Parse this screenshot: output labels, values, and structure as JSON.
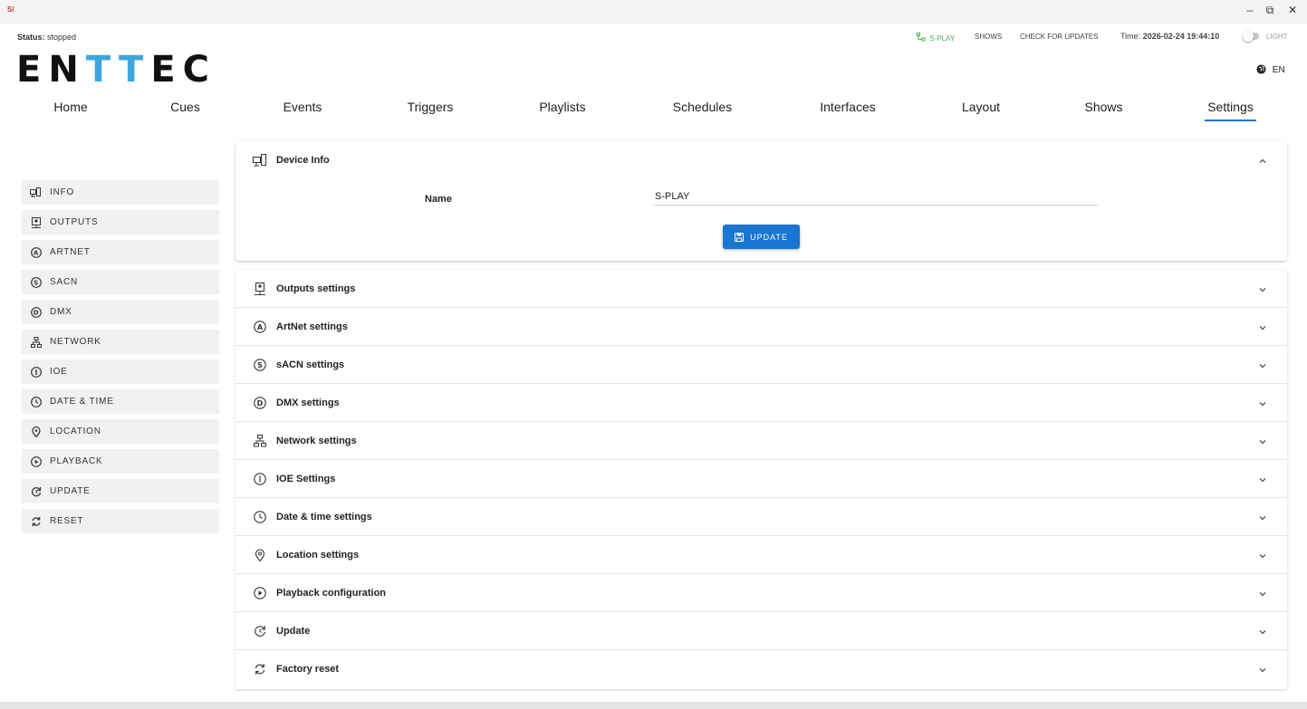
{
  "window": {
    "app_icon": "S/",
    "controls": [
      "–",
      "⧉",
      "✕"
    ]
  },
  "status": {
    "label": "Status:",
    "value": "stopped"
  },
  "logo": {
    "part1": "EN",
    "part2": "TT",
    "part3": "EC"
  },
  "topbar": {
    "splay": "S-PLAY",
    "shows": "SHOWS",
    "check_updates": "CHECK FOR UPDATES",
    "time_label": "Time:",
    "time_value": "2026-02-24 19:44:10",
    "theme_label": "LIGHT",
    "language": "EN"
  },
  "nav": {
    "items": [
      "Home",
      "Cues",
      "Events",
      "Triggers",
      "Playlists",
      "Schedules",
      "Interfaces",
      "Layout",
      "Shows",
      "Settings"
    ],
    "active": "Settings"
  },
  "sidebar": {
    "items": [
      {
        "label": "INFO",
        "icon": "device-info-icon"
      },
      {
        "label": "OUTPUTS",
        "icon": "outputs-icon"
      },
      {
        "label": "ARTNET",
        "icon": "artnet-icon"
      },
      {
        "label": "SACN",
        "icon": "sacn-icon"
      },
      {
        "label": "DMX",
        "icon": "dmx-icon"
      },
      {
        "label": "NETWORK",
        "icon": "network-icon"
      },
      {
        "label": "IOE",
        "icon": "ioe-icon"
      },
      {
        "label": "DATE & TIME",
        "icon": "clock-icon"
      },
      {
        "label": "LOCATION",
        "icon": "location-pin-icon"
      },
      {
        "label": "PLAYBACK",
        "icon": "play-circle-icon"
      },
      {
        "label": "UPDATE",
        "icon": "update-icon"
      },
      {
        "label": "RESET",
        "icon": "reset-icon"
      }
    ]
  },
  "device_info": {
    "title": "Device Info",
    "name_label": "Name",
    "name_value": "S-PLAY",
    "update_button": "UPDATE"
  },
  "sections": [
    {
      "label": "Outputs settings",
      "icon": "outputs-icon"
    },
    {
      "label": "ArtNet settings",
      "icon": "artnet-icon"
    },
    {
      "label": "sACN settings",
      "icon": "sacn-icon"
    },
    {
      "label": "DMX settings",
      "icon": "dmx-icon"
    },
    {
      "label": "Network settings",
      "icon": "network-icon"
    },
    {
      "label": "IOE Settings",
      "icon": "ioe-icon"
    },
    {
      "label": "Date & time settings",
      "icon": "clock-icon"
    },
    {
      "label": "Location settings",
      "icon": "location-pin-icon"
    },
    {
      "label": "Playback configuration",
      "icon": "play-circle-icon"
    },
    {
      "label": "Update",
      "icon": "update-icon"
    },
    {
      "label": "Factory reset",
      "icon": "reset-icon"
    }
  ],
  "colors": {
    "accent": "#1976d2",
    "logo_blue": "#3ea6df",
    "splay_green": "#4caf50",
    "sidebar_bg": "#f1f1f1"
  }
}
